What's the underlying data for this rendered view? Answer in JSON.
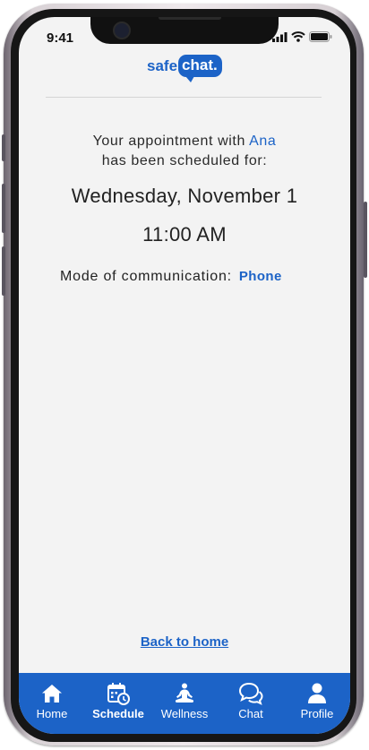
{
  "status_bar": {
    "time": "9:41"
  },
  "logo": {
    "part1": "safe",
    "part2": "chat."
  },
  "confirmation": {
    "line1_prefix": "Your appointment with ",
    "counselor_name": "Ana",
    "line2": "has been scheduled for:"
  },
  "appointment": {
    "date": "Wednesday, November 1",
    "time": "11:00 AM"
  },
  "mode": {
    "label": "Mode of communication:",
    "value": "Phone"
  },
  "back_link": "Back to home",
  "tabbar": {
    "active": "Schedule",
    "items": [
      {
        "label": "Home",
        "icon": "home-icon"
      },
      {
        "label": "Schedule",
        "icon": "calendar-clock-icon"
      },
      {
        "label": "Wellness",
        "icon": "meditation-icon"
      },
      {
        "label": "Chat",
        "icon": "chat-bubbles-icon"
      },
      {
        "label": "Profile",
        "icon": "person-icon"
      }
    ]
  },
  "colors": {
    "accent": "#1c63c7",
    "background": "#f3f3f3",
    "tabbar": "#1c63c7"
  }
}
